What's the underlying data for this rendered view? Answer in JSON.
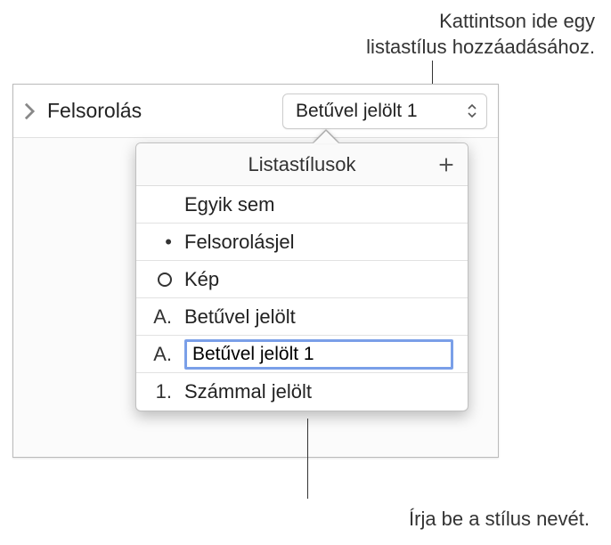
{
  "callouts": {
    "top_line1": "Kattintson ide egy",
    "top_line2": "listastílus hozzáadásához.",
    "bottom": "Írja be a stílus nevét."
  },
  "panel": {
    "section_label": "Felsorolás",
    "dropdown_value": "Betűvel jelölt 1"
  },
  "popover": {
    "title": "Listastílusok",
    "items": [
      {
        "marker": "",
        "label": "Egyik sem"
      },
      {
        "marker": "•",
        "label": "Felsorolásjel"
      },
      {
        "marker": "◯",
        "label": "Kép"
      },
      {
        "marker": "A.",
        "label": "Betűvel jelölt"
      },
      {
        "marker": "A.",
        "label": "Betűvel jelölt 1"
      },
      {
        "marker": "1.",
        "label": "Számmal jelölt"
      }
    ]
  }
}
